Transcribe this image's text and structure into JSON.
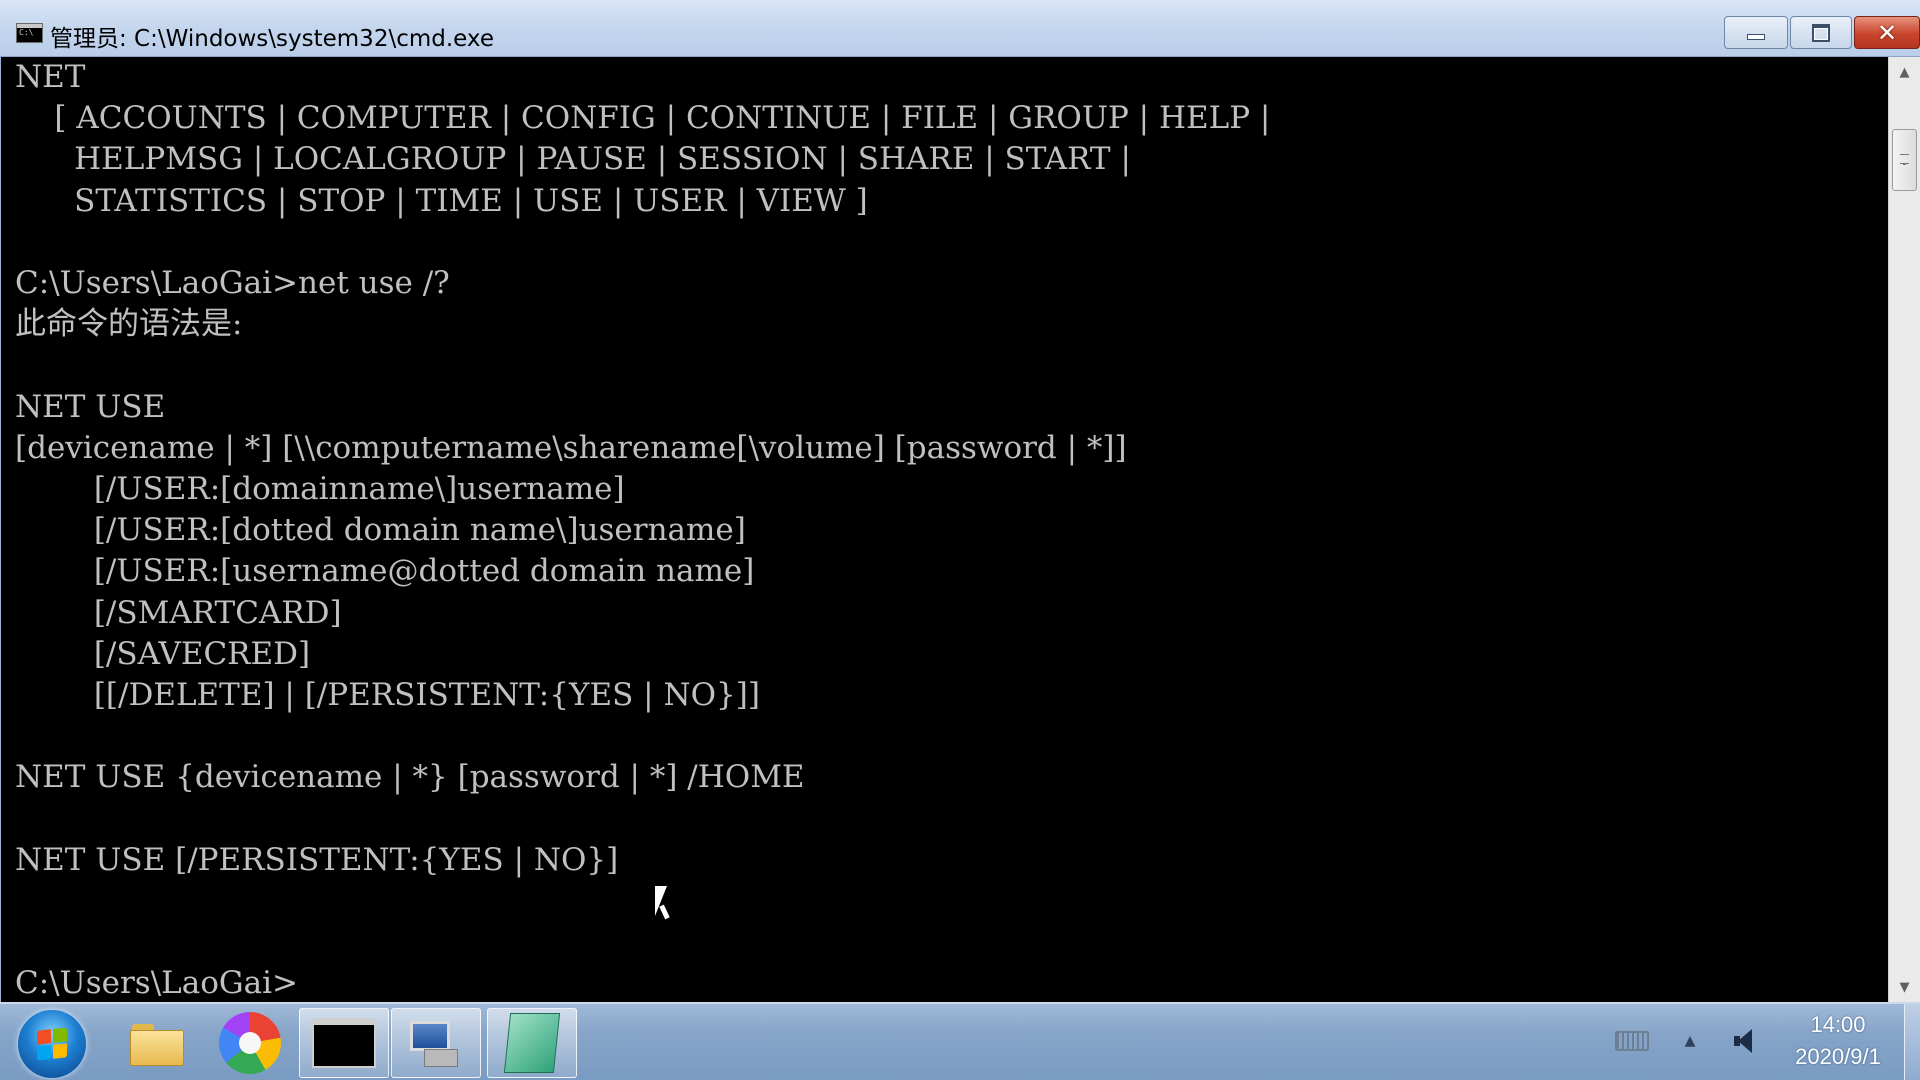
{
  "window": {
    "title": "管理员: C:\\Windows\\system32\\cmd.exe",
    "app_icon": "cmd-icon",
    "controls": {
      "minimize": "minimize-icon",
      "maximize": "maximize-icon",
      "close_glyph": "✕"
    }
  },
  "console": {
    "text": "NET\n    [ ACCOUNTS | COMPUTER | CONFIG | CONTINUE | FILE | GROUP | HELP |\n      HELPMSG | LOCALGROUP | PAUSE | SESSION | SHARE | START |\n      STATISTICS | STOP | TIME | USE | USER | VIEW ]\n\nC:\\Users\\LaoGai>net use /?\n此命令的语法是:\n\nNET USE\n[devicename | *] [\\\\computername\\sharename[\\volume] [password | *]]\n        [/USER:[domainname\\]username]\n        [/USER:[dotted domain name\\]username]\n        [/USER:[username@dotted domain name]\n        [/SMARTCARD]\n        [/SAVECRED]\n        [[/DELETE] | [/PERSISTENT:{YES | NO}]]\n\nNET USE {devicename | *} [password | *] /HOME\n\nNET USE [/PERSISTENT:{YES | NO}]\n\n\nC:\\Users\\LaoGai>",
    "foreground": "#c0c0c0",
    "background": "#000000"
  },
  "scrollbar": {
    "up_arrow": "▲",
    "down_arrow": "▼"
  },
  "taskbar": {
    "start": "start-orb-icon",
    "pinned": [
      {
        "name": "file-explorer-icon"
      },
      {
        "name": "browser-icon"
      },
      {
        "name": "command-prompt-icon",
        "active": true
      },
      {
        "name": "network-icon"
      },
      {
        "name": "notes-icon"
      }
    ],
    "tray": {
      "overflow_arrow": "▲",
      "time": "14:00",
      "date": "2020/9/1"
    }
  }
}
